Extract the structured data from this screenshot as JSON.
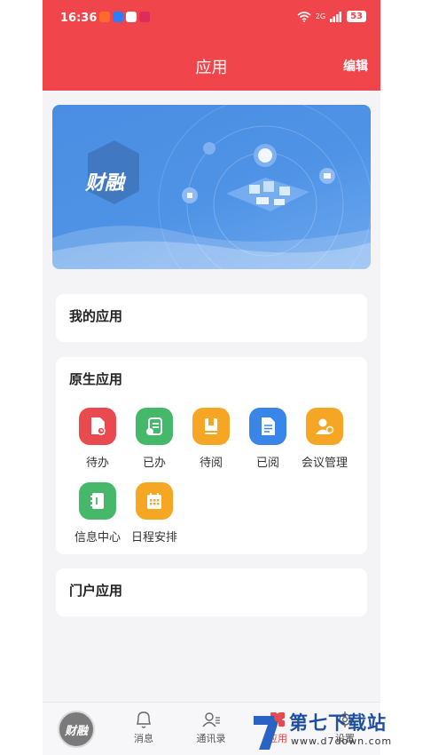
{
  "status_bar": {
    "time": "16:36",
    "network": "2G",
    "battery": "53"
  },
  "header": {
    "title": "应用",
    "edit_label": "编辑"
  },
  "banner": {
    "logo_text": "财融"
  },
  "my_apps": {
    "title": "我的应用"
  },
  "native_apps": {
    "title": "原生应用",
    "items": [
      {
        "label": "待办",
        "icon": "pending-doc-icon",
        "color": "#e94a4f"
      },
      {
        "label": "已办",
        "icon": "done-doc-icon",
        "color": "#45b86a"
      },
      {
        "label": "待阅",
        "icon": "unread-book-icon",
        "color": "#f5a623"
      },
      {
        "label": "已阅",
        "icon": "read-doc-icon",
        "color": "#3a86e8"
      },
      {
        "label": "会议管理",
        "icon": "meeting-icon",
        "color": "#f5a623"
      },
      {
        "label": "信息中心",
        "icon": "info-book-icon",
        "color": "#45b86a"
      },
      {
        "label": "日程安排",
        "icon": "calendar-icon",
        "color": "#f5a623"
      }
    ]
  },
  "portal_apps": {
    "title": "门户应用"
  },
  "tabbar": {
    "avatar_text": "财融",
    "tabs": [
      {
        "label": "消息",
        "icon": "bell-icon"
      },
      {
        "label": "通讯录",
        "icon": "contacts-icon"
      },
      {
        "label": "应用",
        "icon": "apps-icon"
      },
      {
        "label": "设置",
        "icon": "gear-icon"
      }
    ]
  },
  "watermark": {
    "name": "第七下载站",
    "url": "www.d7down.com"
  }
}
